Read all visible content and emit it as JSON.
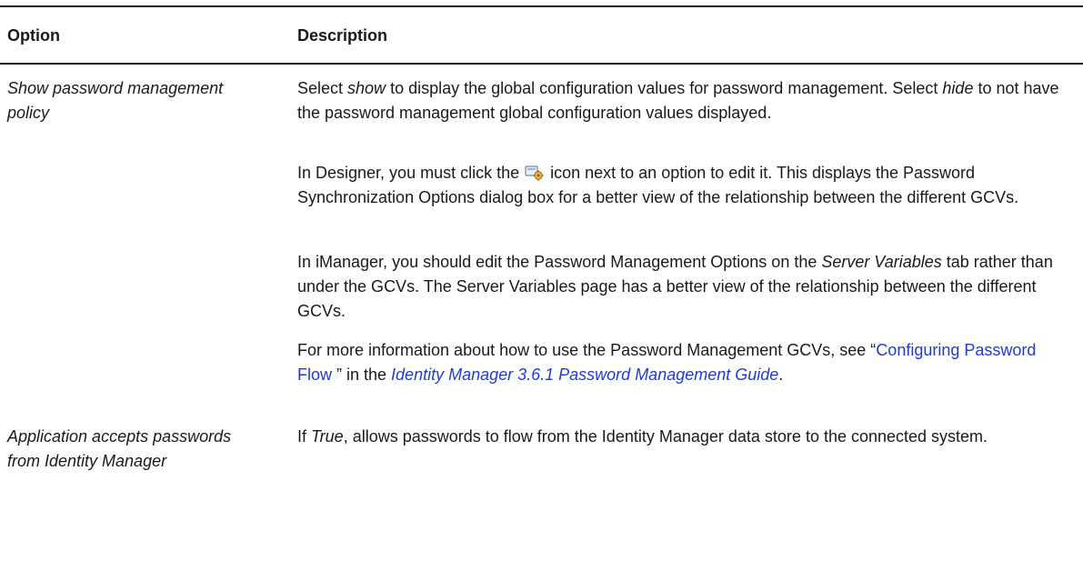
{
  "table": {
    "headers": {
      "option": "Option",
      "description": "Description"
    },
    "row1": {
      "option": "Show password management policy",
      "p1": {
        "a": "Select ",
        "b": "show",
        "c": " to display the global configuration values for password management. Select ",
        "d": "hide",
        "e": " to not have the password management global configuration values displayed."
      },
      "p2": {
        "a": "In Designer, you must click the ",
        "b": " icon next to an option to edit it. This displays the Password Synchronization Options dialog box for a better view of the relationship between the different GCVs."
      },
      "p3": {
        "a": "In iManager, you should edit the Password Management Options on the ",
        "b": "Server Variables",
        "c": " tab rather than under the GCVs. The Server Variables page has a better view of the relationship between the different GCVs."
      },
      "p4": {
        "a": "For more information about how to use the Password Management GCVs, see “",
        "link1": "Configuring Password Flow ",
        "b": "” in the ",
        "link2": "Identity Manager 3.6.1 Password Management Guide",
        "c": "."
      }
    },
    "row2": {
      "option": "Application accepts passwords from Identity Manager",
      "p1": {
        "a": "If ",
        "b": "True",
        "c": ", allows passwords to flow from the Identity Manager data store to the connected system."
      }
    }
  },
  "icons": {
    "edit": "edit-gear-icon"
  },
  "colors": {
    "link": "#1f3bd6",
    "rule": "#1a1a1a"
  }
}
